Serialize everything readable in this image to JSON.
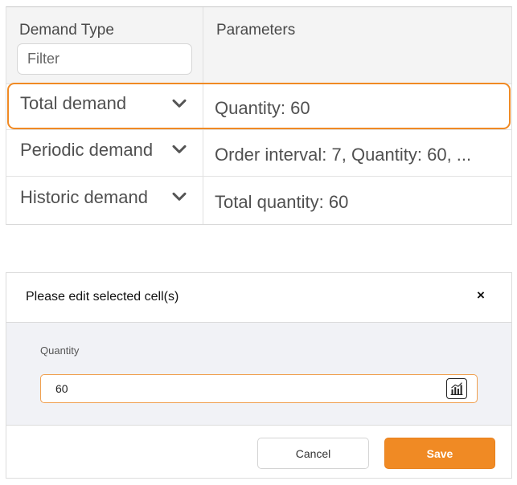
{
  "grid": {
    "columns": {
      "demand_type": "Demand Type",
      "parameters": "Parameters"
    },
    "filter": {
      "placeholder": "Filter",
      "value": ""
    },
    "rows": [
      {
        "type": "Total demand",
        "parameters": "Quantity: 60",
        "selected": true
      },
      {
        "type": "Periodic demand",
        "parameters": "Order interval: 7, Quantity: 60, ...",
        "selected": false
      },
      {
        "type": "Historic demand",
        "parameters": "Total quantity: 60",
        "selected": false
      }
    ]
  },
  "editor": {
    "title": "Please edit selected cell(s)",
    "close_label": "×",
    "field_label": "Quantity",
    "field_value": "60",
    "cancel_label": "Cancel",
    "save_label": "Save"
  },
  "icons": {
    "dropdown": "chevron-down-icon",
    "close": "close-icon",
    "chart": "chart-icon"
  },
  "colors": {
    "accent": "#f08a24",
    "header_bg": "#f4f4f4",
    "panel_body_bg": "#f1f2f6"
  }
}
